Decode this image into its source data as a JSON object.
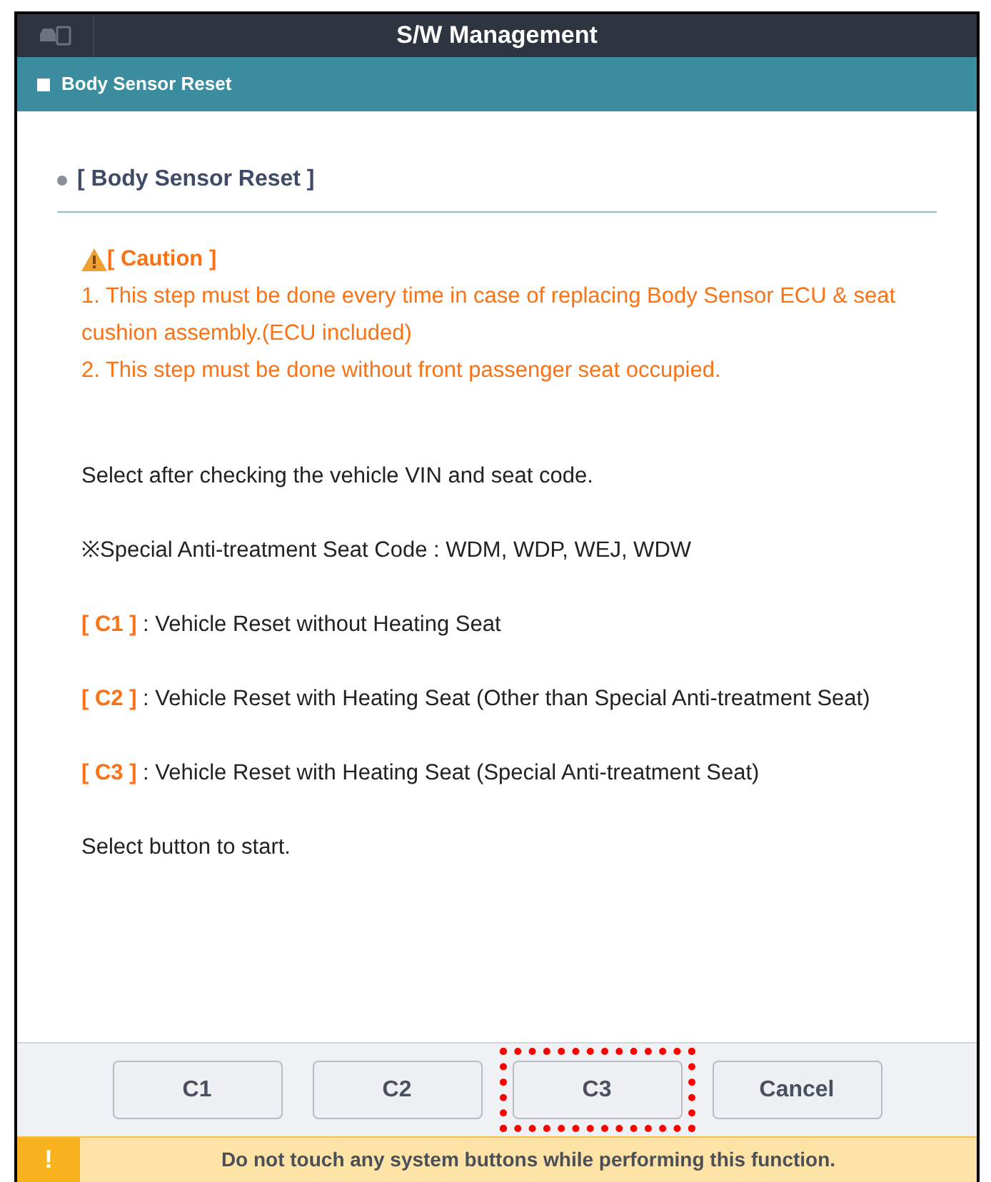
{
  "window": {
    "title": "S/W Management"
  },
  "section_bar": {
    "title": "Body Sensor Reset"
  },
  "heading": "[ Body Sensor Reset ]",
  "caution": {
    "title": "[ Caution ]",
    "lines": [
      "1. This step must be done every time in case of replacing Body Sensor ECU & seat cushion assembly.(ECU included)",
      "2. This step must be done without front passenger seat occupied."
    ]
  },
  "paragraphs": [
    {
      "kind": "plain",
      "text": "Select after checking the vehicle VIN and seat code."
    },
    {
      "kind": "plain",
      "text": "※Special Anti-treatment Seat Code : WDM, WDP, WEJ, WDW"
    },
    {
      "kind": "option",
      "tag": "[ C1 ]",
      "text": " : Vehicle Reset without Heating Seat"
    },
    {
      "kind": "option",
      "tag": "[ C2 ]",
      "text": " : Vehicle Reset with Heating Seat (Other than Special Anti-treatment Seat)"
    },
    {
      "kind": "option",
      "tag": "[ C3 ]",
      "text": " : Vehicle Reset with Heating Seat (Special Anti-treatment Seat)"
    },
    {
      "kind": "plain",
      "text": "Select button to start."
    }
  ],
  "buttons": [
    {
      "label": "C1",
      "highlighted": false
    },
    {
      "label": "C2",
      "highlighted": false
    },
    {
      "label": "C3",
      "highlighted": true
    },
    {
      "label": "Cancel",
      "highlighted": false
    }
  ],
  "warning": {
    "icon": "!",
    "text": "Do not touch any system buttons while performing this function."
  }
}
